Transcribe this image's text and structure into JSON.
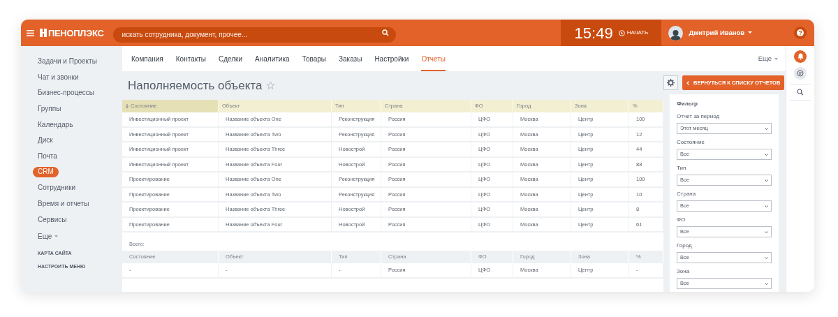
{
  "header": {
    "logo": "ПЕНОПЛЭКС",
    "search": {
      "placeholder": "искать сотрудника, документ, прочее..."
    },
    "clock": "15:49",
    "start_label": "НАЧАТЬ",
    "user_name": "Дмитрий Иванов"
  },
  "sidebar": {
    "items": [
      {
        "label": "Задачи и Проекты",
        "selected": false
      },
      {
        "label": "Чат и звонки",
        "selected": false
      },
      {
        "label": "Бизнес-процессы",
        "selected": false
      },
      {
        "label": "Группы",
        "selected": false
      },
      {
        "label": "Календарь",
        "selected": false
      },
      {
        "label": "Диск",
        "selected": false
      },
      {
        "label": "Почта",
        "selected": false
      },
      {
        "label": "CRM",
        "selected": true
      },
      {
        "label": "Сотрудники",
        "selected": false
      },
      {
        "label": "Время и отчеты",
        "selected": false
      },
      {
        "label": "Сервисы",
        "selected": false
      }
    ],
    "more": "Еще",
    "links": [
      "КАРТА САЙТА",
      "НАСТРОИТЬ МЕНЮ"
    ]
  },
  "tabs": [
    {
      "label": "Компания",
      "selected": false
    },
    {
      "label": "Контакты",
      "selected": false
    },
    {
      "label": "Сделки",
      "selected": false
    },
    {
      "label": "Аналитика",
      "selected": false
    },
    {
      "label": "Товары",
      "selected": false
    },
    {
      "label": "Заказы",
      "selected": false
    },
    {
      "label": "Настройки",
      "selected": false
    },
    {
      "label": "Отчеты",
      "selected": true
    }
  ],
  "tabs_more": "Еще",
  "page_title": "Наполняемость объекта",
  "back_button": "ВЕРНУТЬСЯ К СПИСКУ ОТЧЕТОВ",
  "table": {
    "columns": [
      {
        "label": "Состояние",
        "sorted": true
      },
      {
        "label": "Объект",
        "sorted": false
      },
      {
        "label": "Тип",
        "sorted": false
      },
      {
        "label": "Страна",
        "sorted": false
      },
      {
        "label": "ФО",
        "sorted": false
      },
      {
        "label": "Город",
        "sorted": false
      },
      {
        "label": "Зона",
        "sorted": false
      },
      {
        "label": "%",
        "sorted": false
      }
    ],
    "rows": [
      [
        "Инвестиционный проект",
        "Название объекта One",
        "Реконструкция",
        "Россия",
        "ЦФО",
        "Москва",
        "Центр",
        "100"
      ],
      [
        "Инвестиционный проект",
        "Название объекта Two",
        "Реконструкция",
        "Россия",
        "ЦФО",
        "Москва",
        "Центр",
        "12"
      ],
      [
        "Инвестиционный проект",
        "Название объекта Three",
        "Новострой",
        "Россия",
        "ЦФО",
        "Москва",
        "Центр",
        "44"
      ],
      [
        "Инвестиционный проект",
        "Название объекта Four",
        "Новострой",
        "Россия",
        "ЦФО",
        "Москва",
        "Центр",
        "88"
      ],
      [
        "Проектирование",
        "Название объекта One",
        "Реконструкция",
        "Россия",
        "ЦФО",
        "Москва",
        "Центр",
        "100"
      ],
      [
        "Проектирование",
        "Название объекта Two",
        "Реконструкция",
        "Россия",
        "ЦФО",
        "Москва",
        "Центр",
        "10"
      ],
      [
        "Проектирование",
        "Название объекта Three",
        "Новострой",
        "Россия",
        "ЦФО",
        "Москва",
        "Центр",
        "8"
      ],
      [
        "Проектирование",
        "Название объекта Four",
        "Новострой",
        "Россия",
        "ЦФО",
        "Москва",
        "Центр",
        "61"
      ]
    ]
  },
  "total": {
    "label": "Всего:",
    "columns": [
      "Состояние",
      "Объект",
      "Тип",
      "Страна",
      "ФО",
      "Город",
      "Зона",
      "%"
    ],
    "row": [
      "-",
      "-",
      "-",
      "Россия",
      "ЦФО",
      "Москва",
      "Центр",
      "-"
    ]
  },
  "filter": {
    "title": "Фильтр",
    "fields": [
      {
        "label": "Отчет за период",
        "value": "Этот месяц"
      },
      {
        "label": "Состояние",
        "value": "Все"
      },
      {
        "label": "Тип",
        "value": "Все"
      },
      {
        "label": "Страна",
        "value": "Все"
      },
      {
        "label": "ФО",
        "value": "Все"
      },
      {
        "label": "Город",
        "value": "Все"
      },
      {
        "label": "Зона",
        "value": "Все"
      }
    ]
  }
}
